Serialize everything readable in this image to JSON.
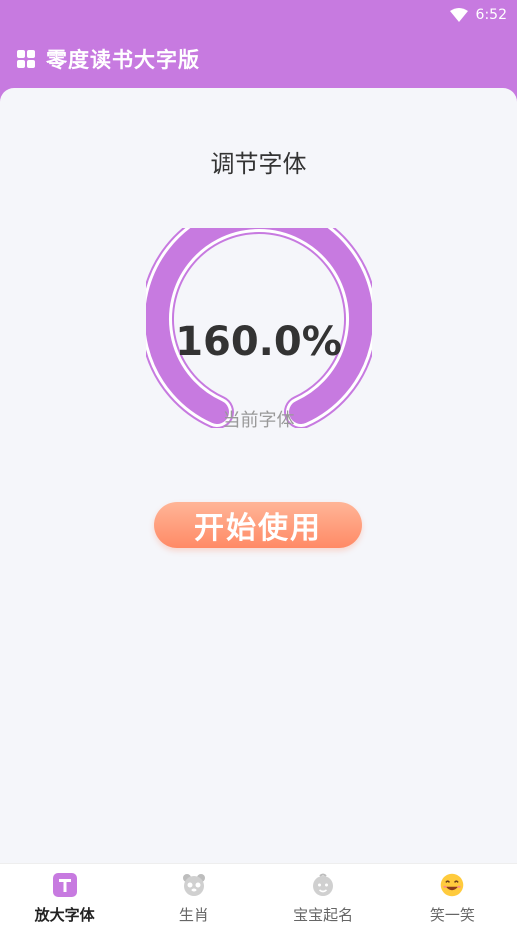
{
  "status_bar": {
    "time": "6:52"
  },
  "app_bar": {
    "title": "零度读书大字版"
  },
  "main": {
    "section_title": "调节字体",
    "gauge": {
      "value_text": "160.0%",
      "caption": "当前字体",
      "color": "#c77ae0"
    },
    "start_button_label": "开始使用"
  },
  "tabs": [
    {
      "label": "放大字体",
      "icon": "font-size-icon",
      "active": true
    },
    {
      "label": "生肖",
      "icon": "panda-icon",
      "active": false
    },
    {
      "label": "宝宝起名",
      "icon": "baby-icon",
      "active": false
    },
    {
      "label": "笑一笑",
      "icon": "smile-icon",
      "active": false
    }
  ],
  "colors": {
    "accent": "#c77ae0",
    "button": "#ff8a66",
    "background": "#f5f6fa"
  }
}
